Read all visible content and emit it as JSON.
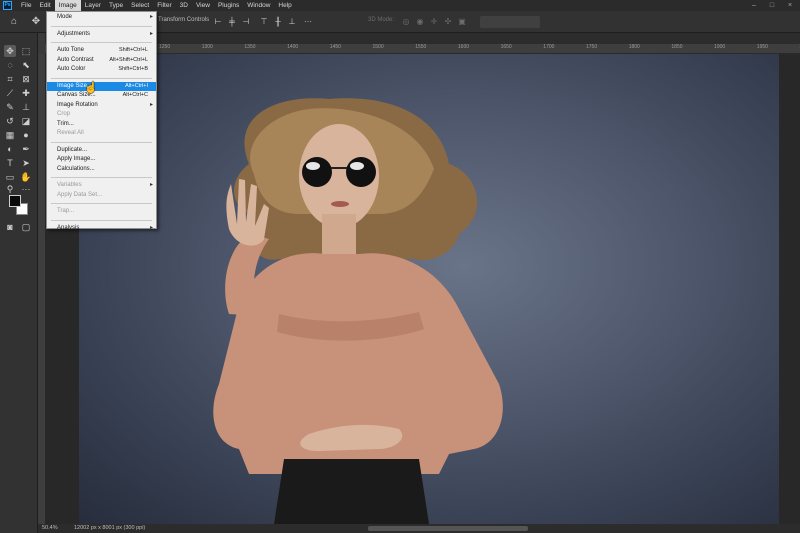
{
  "app": {
    "logo_text": "Ps"
  },
  "menubar": {
    "items": [
      "File",
      "Edit",
      "Image",
      "Layer",
      "Type",
      "Select",
      "Filter",
      "3D",
      "View",
      "Plugins",
      "Window",
      "Help"
    ],
    "active_index": 2
  },
  "options_bar": {
    "show_transform": "Transform Controls",
    "mode_3d": "3D Mode:"
  },
  "ruler_ticks": [
    "1250",
    "1300",
    "1350",
    "1400",
    "1450",
    "1500",
    "1550",
    "1600",
    "1650",
    "1700",
    "1750",
    "1800",
    "1850",
    "1900",
    "1950",
    "2000",
    "2050"
  ],
  "image_menu": {
    "items": [
      {
        "label": "Mode",
        "submenu": true
      },
      {
        "sep": true
      },
      {
        "label": "Adjustments",
        "submenu": true
      },
      {
        "sep": true
      },
      {
        "label": "Auto Tone",
        "shortcut": "Shift+Ctrl+L"
      },
      {
        "label": "Auto Contrast",
        "shortcut": "Alt+Shift+Ctrl+L"
      },
      {
        "label": "Auto Color",
        "shortcut": "Shift+Ctrl+B"
      },
      {
        "sep": true
      },
      {
        "label": "Image Size...",
        "shortcut": "Alt+Ctrl+I",
        "highlighted": true
      },
      {
        "label": "Canvas Size...",
        "shortcut": "Alt+Ctrl+C"
      },
      {
        "label": "Image Rotation",
        "submenu": true
      },
      {
        "label": "Crop",
        "disabled": true
      },
      {
        "label": "Trim..."
      },
      {
        "label": "Reveal All",
        "disabled": true
      },
      {
        "sep": true
      },
      {
        "label": "Duplicate..."
      },
      {
        "label": "Apply Image..."
      },
      {
        "label": "Calculations..."
      },
      {
        "sep": true
      },
      {
        "label": "Variables",
        "submenu": true,
        "disabled": true
      },
      {
        "label": "Apply Data Set...",
        "disabled": true
      },
      {
        "sep": true
      },
      {
        "label": "Trap...",
        "disabled": true
      },
      {
        "sep": true
      },
      {
        "label": "Analysis",
        "submenu": true
      }
    ]
  },
  "status": {
    "zoom": "50.4%",
    "doc_info": "12002 px x 8001 px (300 ppi)"
  },
  "colors": {
    "highlight": "#1a8ae5",
    "photo_bg": "#4b5468"
  }
}
